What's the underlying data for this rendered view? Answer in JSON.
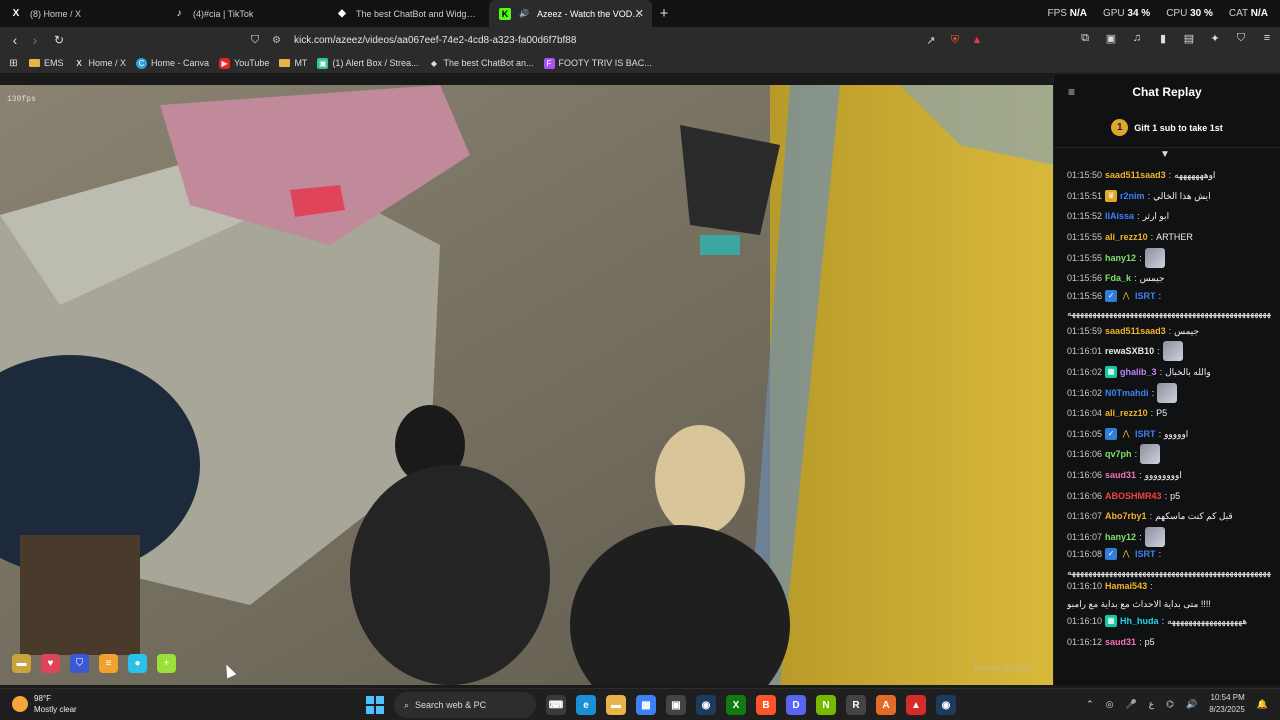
{
  "tabs": [
    {
      "icon": "x-logo-icon",
      "glyph": "X",
      "label": "(8) Home / X",
      "active": false
    },
    {
      "icon": "tiktok-icon",
      "glyph": "♪",
      "label": "(4)#cia | TikTok",
      "active": false
    },
    {
      "icon": "chatbot-icon",
      "glyph": "◆",
      "label": "The best ChatBot and Widgets for Ki",
      "active": false
    },
    {
      "icon": "kick-icon",
      "glyph": "K",
      "label": "Azeez - Watch the VOD on Ki",
      "active": true
    }
  ],
  "perf": {
    "fps_label": "FPS",
    "fps_value": "N/A",
    "gpu_label": "GPU",
    "gpu_value": "34 %",
    "cpu_label": "CPU",
    "cpu_value": "30 %",
    "cat_label": "CAT",
    "cat_value": "N/A"
  },
  "address": {
    "url": "kick.com/azeez/videos/aa067eef-74e2-4cd8-a323-fa00d6f7bf88"
  },
  "bookmarks": [
    {
      "icon": "folder-icon",
      "label": "EMS"
    },
    {
      "icon": "x-logo-icon",
      "label": "Home / X"
    },
    {
      "icon": "canva-icon",
      "label": "Home - Canva"
    },
    {
      "icon": "youtube-icon",
      "label": "YouTube"
    },
    {
      "icon": "folder-icon",
      "label": "MT"
    },
    {
      "icon": "alertbox-icon",
      "label": "(1) Alert Box / Strea..."
    },
    {
      "icon": "chatbot-icon",
      "label": "The best ChatBot an..."
    },
    {
      "icon": "footy-icon",
      "label": "FOOTY TRIV IS BAC..."
    }
  ],
  "video": {
    "fps_overlay": "130fps",
    "watermark": "FiveM® (b3258)"
  },
  "chat": {
    "title": "Chat Replay",
    "gift_rank": "1",
    "gift_text": "Gift 1 sub to take 1st",
    "messages": [
      {
        "ts": "01:15:50",
        "user": "saad511saad3",
        "color": "#f0b429",
        "badges": [],
        "text": "اوهههههههه"
      },
      {
        "ts": "01:15:51",
        "user": "r2nim",
        "color": "#3b82f6",
        "badges": [
          "crown"
        ],
        "text": "ايش هذا الخالي"
      },
      {
        "ts": "01:15:52",
        "user": "IIAissa",
        "color": "#3b82f6",
        "badges": [],
        "text": "ابو ارثر"
      },
      {
        "ts": "01:15:55",
        "user": "ali_rezz10",
        "color": "#f0b429",
        "badges": [],
        "text": "ARTHER"
      },
      {
        "ts": "01:15:55",
        "user": "hany12",
        "color": "#7ee06a",
        "badges": [],
        "emote": true,
        "text": ""
      },
      {
        "ts": "01:15:56",
        "user": "Fda_k",
        "color": "#7ee06a",
        "badges": [],
        "text": "جيمس"
      },
      {
        "ts": "01:15:56",
        "user": "ISRT",
        "color": "#3b82f6",
        "badges": [
          "verified",
          "og"
        ],
        "text": "ههههههههههههههههههههههههههههههههههههههههههههههههههههههههههههههههههههههههه",
        "tall": true
      },
      {
        "ts": "01:15:59",
        "user": "saad511saad3",
        "color": "#f0b429",
        "badges": [],
        "text": "جيمس"
      },
      {
        "ts": "01:16:01",
        "user": "rewaSXB10",
        "color": "#e8e8e8",
        "badges": [],
        "emote": true,
        "text": ""
      },
      {
        "ts": "01:16:02",
        "user": "ghalib_3",
        "color": "#c084fc",
        "badges": [
          "sub"
        ],
        "text": "والله بالخبال"
      },
      {
        "ts": "01:16:02",
        "user": "N0Tmahdi",
        "color": "#3b82f6",
        "badges": [],
        "emote": true,
        "text": ""
      },
      {
        "ts": "01:16:04",
        "user": "ali_rezz10",
        "color": "#f0b429",
        "badges": [],
        "text": "P5"
      },
      {
        "ts": "01:16:05",
        "user": "ISRT",
        "color": "#3b82f6",
        "badges": [
          "verified",
          "og"
        ],
        "text": "اووووو"
      },
      {
        "ts": "01:16:06",
        "user": "qv7ph",
        "color": "#7ee06a",
        "badges": [],
        "emote": true,
        "text": ""
      },
      {
        "ts": "01:16:06",
        "user": "saud31",
        "color": "#f472b6",
        "badges": [],
        "text": "اوووووووو"
      },
      {
        "ts": "01:16:06",
        "user": "ABOSHMR43",
        "color": "#ef4444",
        "badges": [],
        "text": "p5"
      },
      {
        "ts": "01:16:07",
        "user": "Abo7rby1",
        "color": "#f0b429",
        "badges": [],
        "text": "قبل كم كنت ماسكهم"
      },
      {
        "ts": "01:16:07",
        "user": "hany12",
        "color": "#7ee06a",
        "badges": [],
        "emote": true,
        "text": ""
      },
      {
        "ts": "01:16:08",
        "user": "ISRT",
        "color": "#3b82f6",
        "badges": [
          "verified",
          "og"
        ],
        "text": "ههههههههههههههههههههههههههههههههههههههههههههههههههههههههههههههههههههههههه",
        "tall": true
      },
      {
        "ts": "01:16:10",
        "user": "Hamai543",
        "color": "#f0b429",
        "badges": [],
        "text": "متى بداية الاحداث مع بداية مع رامبو !!!!",
        "tall": true
      },
      {
        "ts": "01:16:10",
        "user": "Hh_huda",
        "color": "#22d3ee",
        "badges": [
          "sub"
        ],
        "text": "ههههههههههههههههههه"
      },
      {
        "ts": "01:16:12",
        "user": "saud31",
        "color": "#f472b6",
        "badges": [],
        "text": "p5"
      }
    ]
  },
  "taskbar": {
    "temp": "98°F",
    "condition": "Mostly clear",
    "search_placeholder": "Search web & PC",
    "apps": [
      {
        "icon": "terminal-icon",
        "glyph": "⌨",
        "bg": "#3a3a3a"
      },
      {
        "icon": "edge-icon",
        "glyph": "e",
        "bg": "#1b8fd6"
      },
      {
        "icon": "file-explorer-icon",
        "glyph": "▬",
        "bg": "#e8b44a"
      },
      {
        "icon": "store-icon",
        "glyph": "▦",
        "bg": "#3b82f6"
      },
      {
        "icon": "console-icon",
        "glyph": "▣",
        "bg": "#444"
      },
      {
        "icon": "steam-icon",
        "glyph": "◉",
        "bg": "#1b3c5c"
      },
      {
        "icon": "xbox-icon",
        "glyph": "X",
        "bg": "#107c10"
      },
      {
        "icon": "brave-icon",
        "glyph": "B",
        "bg": "#fb542b"
      },
      {
        "icon": "discord-icon",
        "glyph": "D",
        "bg": "#5865f2"
      },
      {
        "icon": "nvidia-icon",
        "glyph": "N",
        "bg": "#76b900"
      },
      {
        "icon": "rockstar-icon",
        "glyph": "R",
        "bg": "#444"
      },
      {
        "icon": "app-a-icon",
        "glyph": "A",
        "bg": "#e36b2a"
      },
      {
        "icon": "app-red-icon",
        "glyph": "▲",
        "bg": "#d62b2b"
      },
      {
        "icon": "steam-alt-icon",
        "glyph": "◉",
        "bg": "#1b3c5c"
      }
    ],
    "lang": "ع",
    "time": "10:54 PM",
    "date": "8/23/2025"
  }
}
